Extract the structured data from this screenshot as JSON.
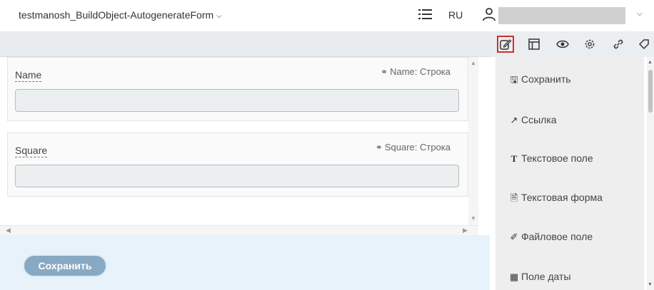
{
  "header": {
    "app_title": "testmanosh_BuildObject-AutogenerateForm",
    "language": "RU",
    "icons": [
      "list-icon",
      "user-icon",
      "chevron-down-icon"
    ]
  },
  "toolbar": {
    "icons": [
      "edit-icon",
      "layout-icon",
      "eye-icon",
      "gear-icon",
      "link-icon",
      "tag-icon"
    ],
    "active_icon": "edit-icon",
    "active_border_color": "#d32f2f"
  },
  "form": {
    "fields": [
      {
        "label": "Name",
        "hint": "Name: Строка",
        "value": ""
      },
      {
        "label": "Square",
        "hint": "Square: Строка",
        "value": ""
      }
    ],
    "save_label": "Сохранить"
  },
  "palette": {
    "items": [
      {
        "icon": "save-icon",
        "label": "Сохранить"
      },
      {
        "icon": "external-link-icon",
        "label": "Ссылка"
      },
      {
        "icon": "text-icon",
        "label": "Текстовое поле"
      },
      {
        "icon": "document-icon",
        "label": "Текстовая форма"
      },
      {
        "icon": "paperclip-icon",
        "label": "Файловое поле"
      },
      {
        "icon": "calendar-icon",
        "label": "Поле даты"
      }
    ]
  },
  "colors": {
    "footer_bg": "#e7f2fa",
    "save_button": "#87a9c3",
    "palette_bg": "#eeeeee"
  }
}
